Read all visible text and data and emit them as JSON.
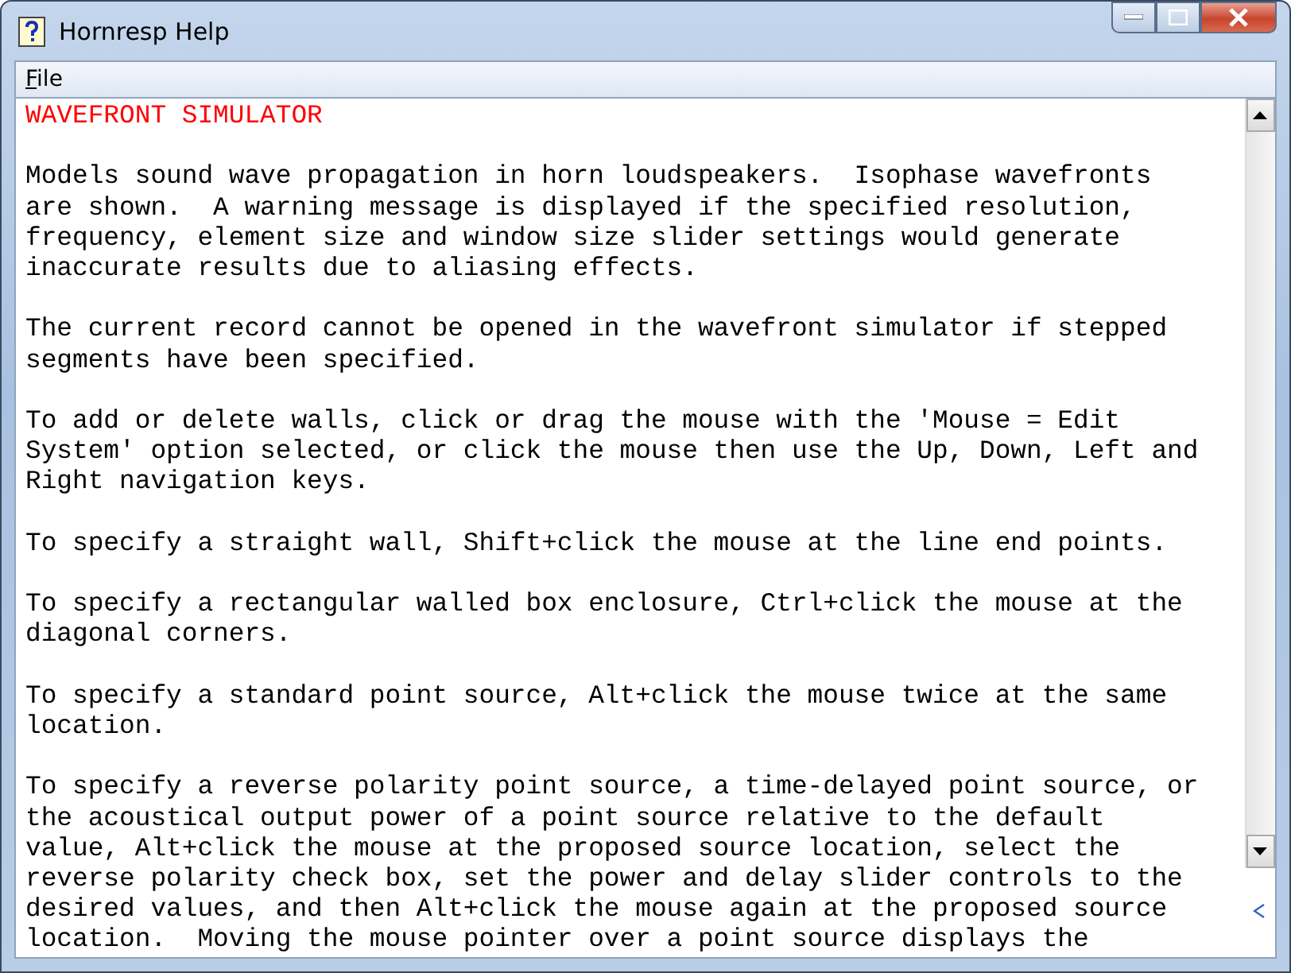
{
  "window": {
    "title": "Hornresp Help"
  },
  "menu": [
    {
      "label": "File"
    }
  ],
  "heading": "WAVEFRONT SIMULATOR",
  "paragraphs": [
    [
      "Models sound wave propagation in horn loudspeakers.  Isophase wavefronts",
      "are shown.  A warning message is displayed if the specified resolution,",
      "frequency, element size and window size slider settings would generate",
      "inaccurate results due to aliasing effects."
    ],
    [
      "The current record cannot be opened in the wavefront simulator if stepped",
      "segments have been specified."
    ],
    [
      "To add or delete walls, click or drag the mouse with the 'Mouse = Edit",
      "System' option selected, or click the mouse then use the Up, Down, Left and",
      "Right navigation keys."
    ],
    [
      "To specify a straight wall, Shift+click the mouse at the line end points."
    ],
    [
      "To specify a rectangular walled box enclosure, Ctrl+click the mouse at the",
      "diagonal corners."
    ],
    [
      "To specify a standard point source, Alt+click the mouse twice at the same",
      "location."
    ],
    [
      "To specify a reverse polarity point source, a time-delayed point source, or",
      "the acoustical output power of a point source relative to the default",
      "value, Alt+click the mouse at the proposed source location, select the",
      "reverse polarity check box, set the power and delay slider controls to the",
      "desired values, and then Alt+click the mouse again at the proposed source",
      "location.  Moving the mouse pointer over a point source displays the"
    ]
  ]
}
